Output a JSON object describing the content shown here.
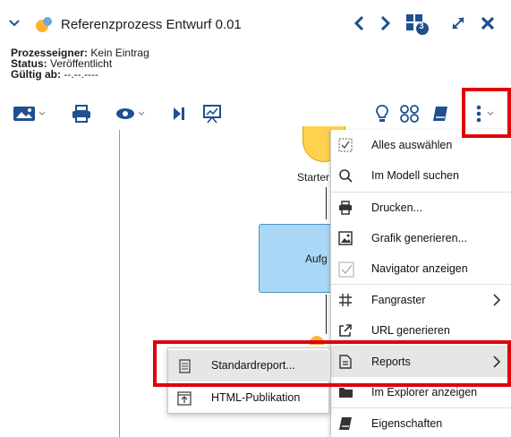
{
  "header": {
    "title": "Referenzprozess Entwurf 0.01",
    "badge_count": "3",
    "meta": [
      {
        "label": "Prozesseigner:",
        "value": "Kein Eintrag"
      },
      {
        "label": "Status:",
        "value": "Veröffentlicht"
      },
      {
        "label": "Gültig ab:",
        "value": "--.--.----"
      }
    ]
  },
  "canvas": {
    "start_label": "Starter",
    "task_label": "Aufg"
  },
  "menu": {
    "items": [
      {
        "label": "Alles auswählen",
        "icon": "select-all-icon"
      },
      {
        "label": "Im Modell suchen",
        "icon": "search-icon"
      },
      {
        "label": "Drucken...",
        "icon": "printer-icon"
      },
      {
        "label": "Grafik generieren...",
        "icon": "image-icon"
      },
      {
        "label": "Navigator anzeigen",
        "icon": "checkbox-icon"
      },
      {
        "label": "Fangraster",
        "icon": "grid-icon"
      },
      {
        "label": "URL generieren",
        "icon": "external-link-icon"
      },
      {
        "label": "Reports",
        "icon": "report-icon"
      },
      {
        "label": "Im Explorer anzeigen",
        "icon": "folder-icon"
      },
      {
        "label": "Eigenschaften",
        "icon": "book-icon"
      }
    ]
  },
  "submenu": {
    "items": [
      {
        "label": "Standardreport...",
        "icon": "document-icon"
      },
      {
        "label": "HTML-Publikation",
        "icon": "html-export-icon"
      }
    ]
  },
  "colors": {
    "accent_blue": "#1f4f8f",
    "highlight_red": "#e0000a",
    "task_fill": "#a9d7f5",
    "start_fill": "#ffd24d"
  }
}
